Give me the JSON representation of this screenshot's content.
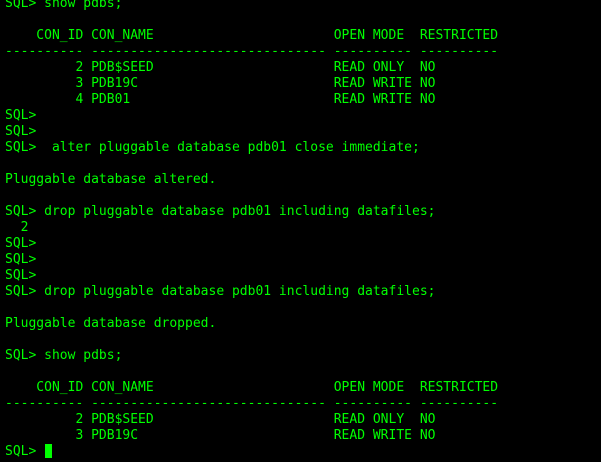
{
  "colors": {
    "background": "#000000",
    "text": "#00ff00"
  },
  "terminal": {
    "lines": [
      "SQL> show pdbs;",
      "",
      "    CON_ID CON_NAME                       OPEN MODE  RESTRICTED",
      "---------- ------------------------------ ---------- ----------",
      "         2 PDB$SEED                       READ ONLY  NO",
      "         3 PDB19C                         READ WRITE NO",
      "         4 PDB01                          READ WRITE NO",
      "SQL>",
      "SQL>",
      "SQL>  alter pluggable database pdb01 close immediate;",
      "",
      "Pluggable database altered.",
      "",
      "SQL> drop pluggable database pdb01 including datafiles;",
      "  2",
      "SQL>",
      "SQL>",
      "SQL>",
      "SQL> drop pluggable database pdb01 including datafiles;",
      "",
      "Pluggable database dropped.",
      "",
      "SQL> show pdbs;",
      "",
      "    CON_ID CON_NAME                       OPEN MODE  RESTRICTED",
      "---------- ------------------------------ ---------- ----------",
      "         2 PDB$SEED                       READ ONLY  NO",
      "         3 PDB19C                         READ WRITE NO"
    ],
    "prompt": "SQL> "
  }
}
